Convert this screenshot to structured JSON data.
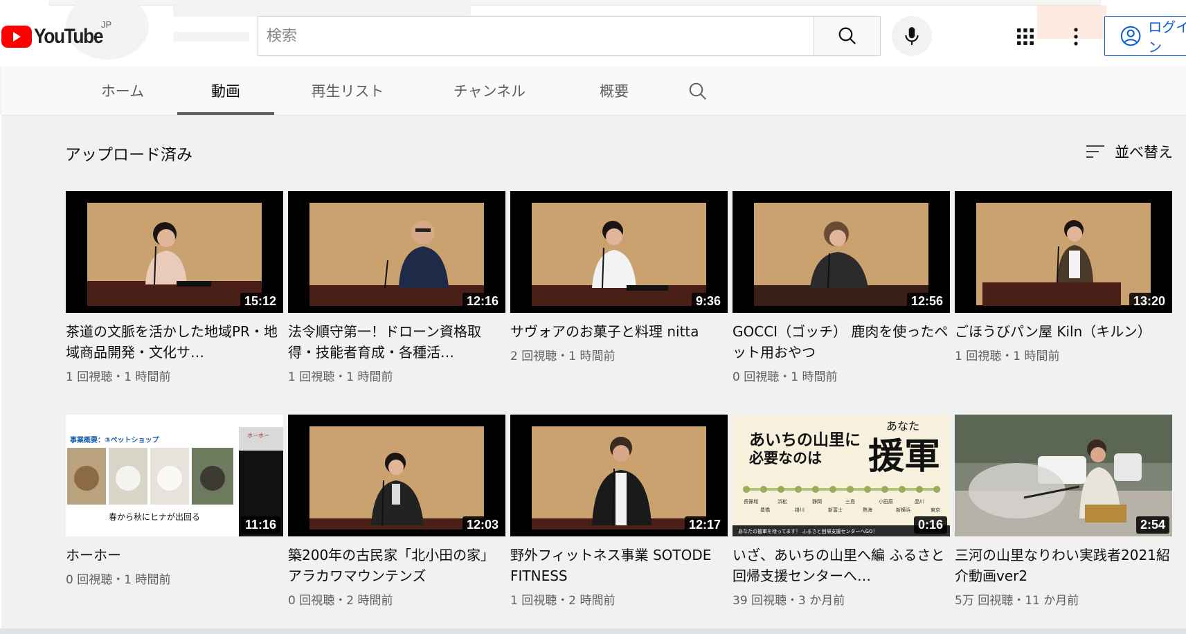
{
  "header": {
    "logo_text": "YouTube",
    "region": "JP",
    "search_placeholder": "検索",
    "signin_label": "ログイン"
  },
  "tabs": [
    {
      "label": "ホーム",
      "active": false
    },
    {
      "label": "動画",
      "active": true
    },
    {
      "label": "再生リスト",
      "active": false
    },
    {
      "label": "チャンネル",
      "active": false
    },
    {
      "label": "概要",
      "active": false
    }
  ],
  "section": {
    "title": "アップロード済み",
    "sort_label": "並べ替え"
  },
  "videos": [
    {
      "title": "茶道の文脈を活かした地域PR・地域商品開発・文化サ…",
      "meta": "1 回視聴・1 時間前",
      "duration": "15:12"
    },
    {
      "title": "法令順守第一！ドローン資格取得・技能者育成・各種活…",
      "meta": "1 回視聴・1 時間前",
      "duration": "12:16"
    },
    {
      "title": "サヴォアのお菓子と料理 nitta",
      "meta": "2 回視聴・1 時間前",
      "duration": "9:36"
    },
    {
      "title": "GOCCI（ゴッチ） 鹿肉を使ったペット用おやつ",
      "meta": "0 回視聴・1 時間前",
      "duration": "12:56"
    },
    {
      "title": "ごほうびパン屋 Kiln（キルン）",
      "meta": "1 回視聴・1 時間前",
      "duration": "13:20"
    },
    {
      "title": "ホーホー",
      "meta": "0 回視聴・1 時間前",
      "duration": "11:16",
      "thumb_text": {
        "heading": "事業概要：③ペットショップ",
        "caption": "春から秋にヒナが出回る",
        "corner": "ホーホー"
      }
    },
    {
      "title": "築200年の古民家「北小田の家」アラカワマウンテンズ",
      "meta": "0 回視聴・2 時間前",
      "duration": "12:03"
    },
    {
      "title": "野外フィットネス事業 SOTODE FITNESS",
      "meta": "1 回視聴・2 時間前",
      "duration": "12:17"
    },
    {
      "title": "いざ、あいちの山里へ編 ふるさと回帰支援センターへ…",
      "meta": "39 回視聴・3 か月前",
      "duration": "0:16",
      "thumb_text": {
        "line1": "あいちの山里に",
        "line2": "必要なのは",
        "ruby": "あなた",
        "big": "援軍",
        "stations": [
          "長篠城",
          "豊橋",
          "浜松",
          "掛川",
          "静岡",
          "新富士",
          "三島",
          "熱海",
          "小田原",
          "新横浜",
          "品川",
          "東京"
        ],
        "footer": "あなたの援軍を待ってます！ ふるさと回帰支援センターへGO！"
      }
    },
    {
      "title": "三河の山里なりわい実践者2021紹介動画ver2",
      "meta": "5万 回視聴・11 か月前",
      "duration": "2:54"
    }
  ]
}
